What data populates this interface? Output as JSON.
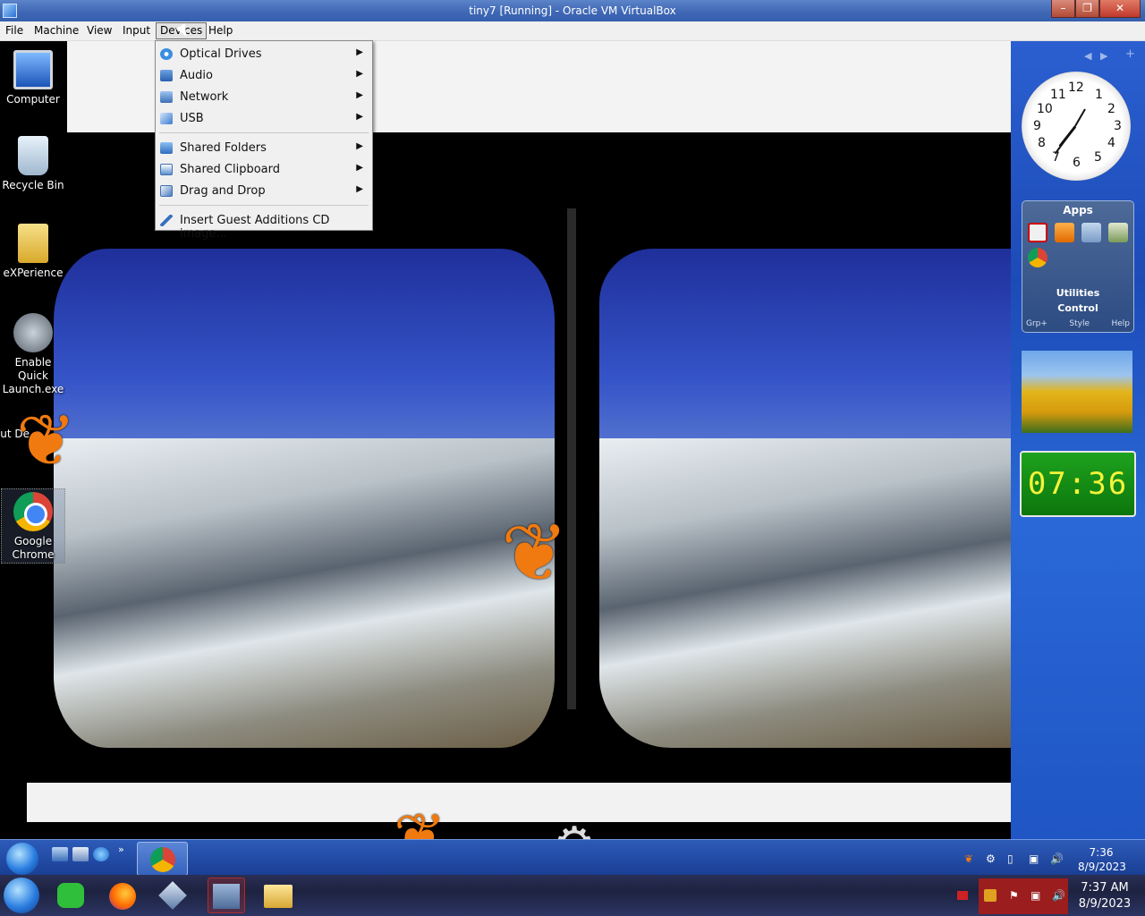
{
  "window": {
    "title": "tiny7 [Running] - Oracle VM VirtualBox"
  },
  "menubar": [
    "File",
    "Machine",
    "View",
    "Input",
    "Devices",
    "Help"
  ],
  "devices_menu": [
    {
      "label": "Optical Drives",
      "icon": "optical-drive-icon",
      "submenu": true
    },
    {
      "label": "Audio",
      "icon": "audio-icon",
      "submenu": true
    },
    {
      "label": "Network",
      "icon": "network-icon",
      "submenu": true
    },
    {
      "label": "USB",
      "icon": "usb-icon",
      "submenu": true
    },
    {
      "label": "Shared Folders",
      "icon": "shared-folders-icon",
      "submenu": true
    },
    {
      "label": "Shared Clipboard",
      "icon": "clipboard-icon",
      "submenu": true
    },
    {
      "label": "Drag and Drop",
      "icon": "drag-drop-icon",
      "submenu": true
    },
    {
      "label": "Insert Guest Additions CD image...",
      "icon": "cd-insert-icon",
      "submenu": false
    }
  ],
  "desktop_icons": [
    {
      "label": "Computer",
      "icon": "computer-icon"
    },
    {
      "label": "Recycle Bin",
      "icon": "recycle-bin-icon"
    },
    {
      "label": "eXPerience",
      "icon": "folder-icon"
    },
    {
      "label": "Enable Quick Launch.exe",
      "icon": "quick-launch-icon"
    },
    {
      "label": "But De",
      "icon": "shortcut-icon"
    },
    {
      "label": "Google Chrome",
      "icon": "chrome-icon"
    }
  ],
  "gadgets": {
    "clock_numbers": [
      "12",
      "1",
      "2",
      "3",
      "4",
      "5",
      "6",
      "7",
      "8",
      "9",
      "10",
      "11"
    ],
    "apps_title": "Apps",
    "apps_labels": [
      "Utilities",
      "Control"
    ],
    "apps_footer": [
      "Grp+",
      "Style",
      "Help"
    ],
    "digital_clock": "07:36"
  },
  "guest_taskbar": {
    "time": "7:36",
    "date": "8/9/2023"
  },
  "host_taskbar": {
    "time": "7:37 AM",
    "date": "8/9/2023"
  },
  "colors": {
    "accent": "#2a5fcf",
    "menu_bg": "#f0f0f0",
    "digital_clock_bg": "#1a921a",
    "digital_clock_fg": "#f6f33a"
  }
}
